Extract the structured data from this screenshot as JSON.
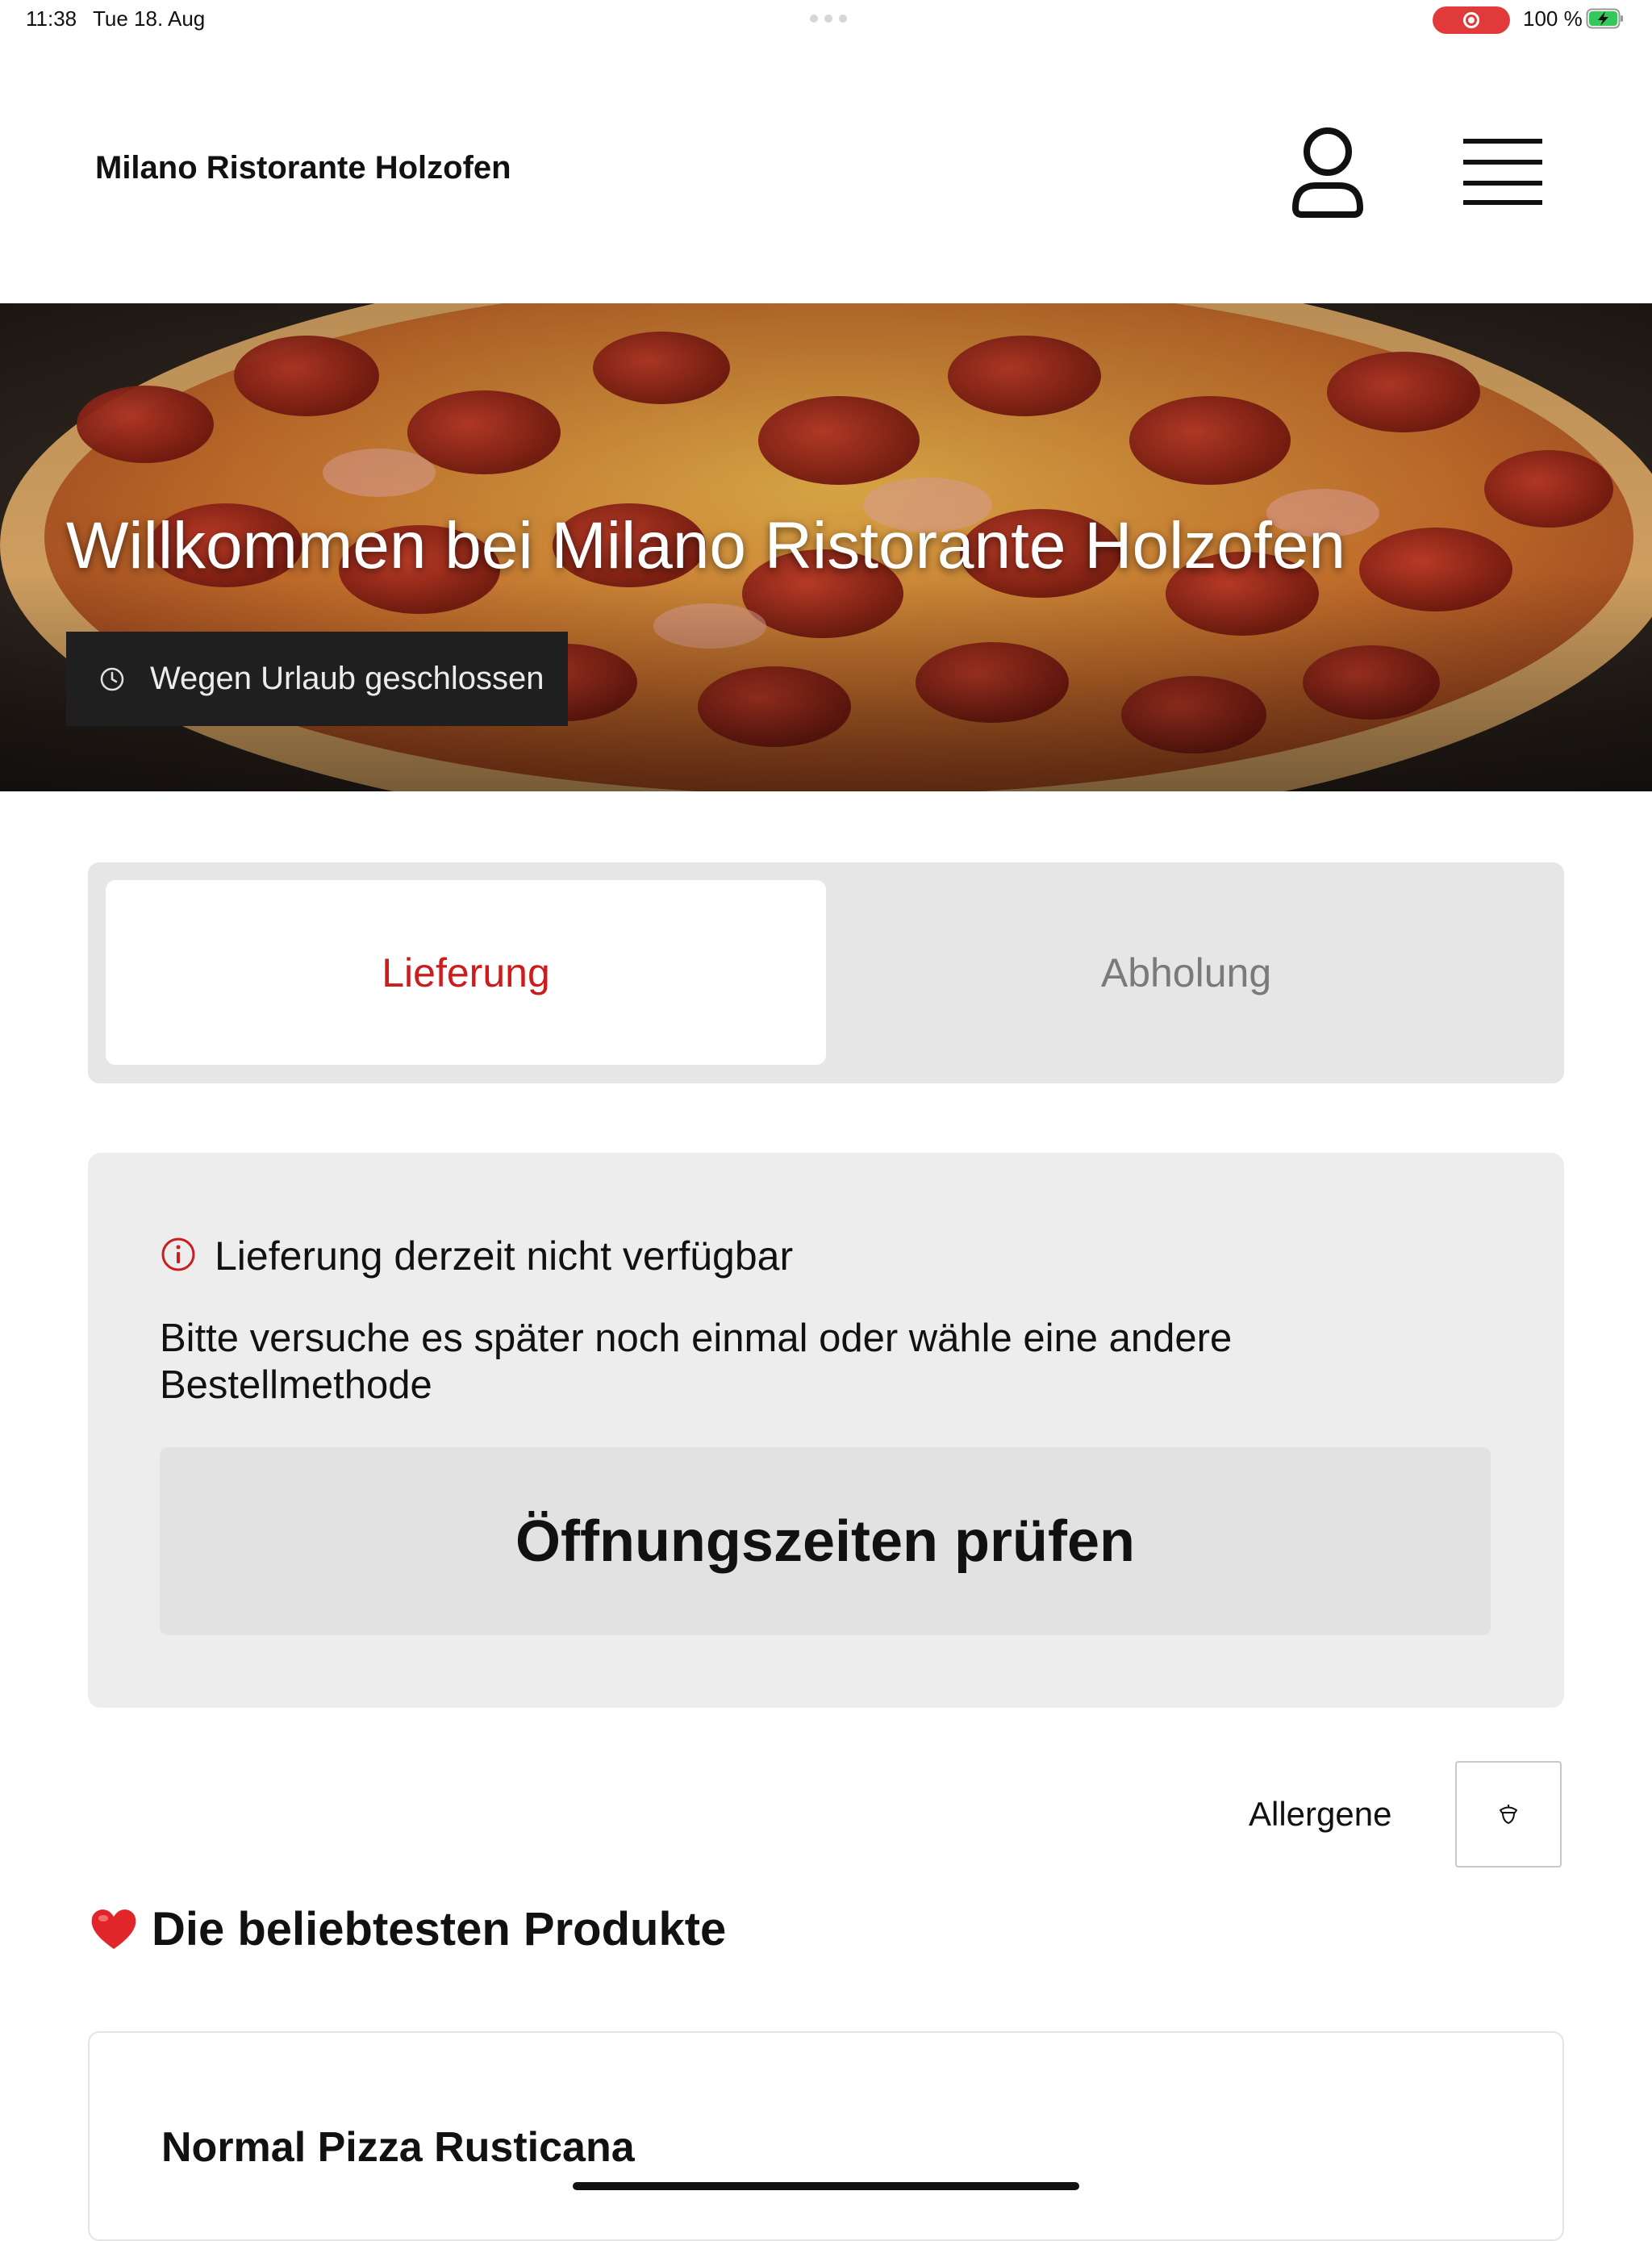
{
  "status_bar": {
    "time": "11:38",
    "date": "Tue 18. Aug",
    "battery": "100 %",
    "recording_color": "#e03a3a"
  },
  "header": {
    "brand": "Milano Ristorante Holzofen",
    "account_icon": "person-icon",
    "menu_icon": "hamburger-menu-icon"
  },
  "hero": {
    "title": "Willkommen bei Milano Ristorante Holzofen",
    "status": "Wegen Urlaub geschlossen",
    "status_icon": "clock-icon"
  },
  "order_tabs": {
    "items": [
      {
        "label": "Lieferung",
        "selected": true
      },
      {
        "label": "Abholung",
        "selected": false
      }
    ],
    "accent_color": "#cc1c1c"
  },
  "notice": {
    "icon": "info-icon",
    "title": "Lieferung derzeit nicht verfügbar",
    "body": "Bitte versuche es später noch einmal oder wähle eine andere Bestellmethode",
    "button": "Öffnungszeiten prüfen"
  },
  "allergens": {
    "label": "Allergene",
    "icon": "acorn-icon"
  },
  "popular": {
    "icon": "heart-icon",
    "title": "Die beliebtesten Produkte",
    "products": [
      {
        "name": "Normal Pizza Rusticana"
      }
    ]
  }
}
